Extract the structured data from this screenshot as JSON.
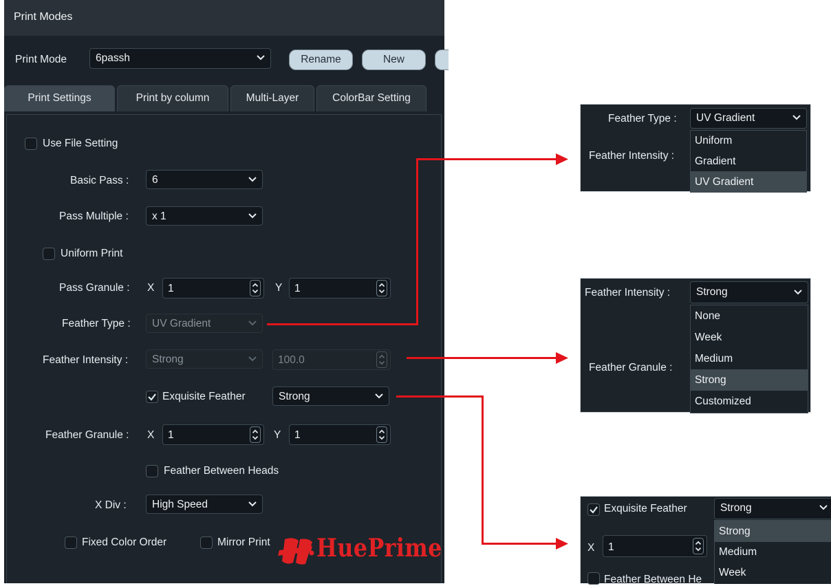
{
  "window": {
    "title": "Print Modes"
  },
  "mode_row": {
    "label": "Print Mode",
    "value": "6passh",
    "rename": "Rename",
    "new": "New"
  },
  "tabs": [
    "Print Settings",
    "Print by column",
    "Multi-Layer",
    "ColorBar Setting"
  ],
  "settings": {
    "use_file_setting": {
      "label": "Use File Setting",
      "checked": false
    },
    "basic_pass": {
      "label": "Basic Pass :",
      "value": "6"
    },
    "pass_multiple": {
      "label": "Pass Multiple :",
      "value": "x 1"
    },
    "uniform_print": {
      "label": "Uniform Print",
      "checked": false
    },
    "pass_granule": {
      "label": "Pass Granule :",
      "x_label": "X",
      "x": "1",
      "y_label": "Y",
      "y": "1"
    },
    "feather_type": {
      "label": "Feather Type :",
      "value": "UV Gradient"
    },
    "feather_intensity": {
      "label": "Feather Intensity :",
      "value": "Strong",
      "number": "100.0"
    },
    "exquisite_feather": {
      "label": "Exquisite Feather",
      "checked": true,
      "value": "Strong"
    },
    "feather_granule": {
      "label": "Feather Granule :",
      "x_label": "X",
      "x": "1",
      "y_label": "Y",
      "y": "1"
    },
    "feather_between_heads": {
      "label": "Feather Between Heads",
      "checked": false
    },
    "x_div": {
      "label": "X Div :",
      "value": "High Speed"
    },
    "fixed_color_order": {
      "label": "Fixed Color Order",
      "checked": false
    },
    "mirror_print": {
      "label": "Mirror Print",
      "checked": false
    }
  },
  "logo": {
    "text": "HuePrime"
  },
  "inset_feather_type": {
    "label": "Feather Type :",
    "value": "UV Gradient",
    "behind_label": "Feather Intensity :",
    "options": [
      "Uniform",
      "Gradient",
      "UV Gradient"
    ],
    "selected": "UV Gradient"
  },
  "inset_feather_intensity": {
    "label": "Feather Intensity :",
    "value": "Strong",
    "behind_label": "Feather Granule :",
    "options": [
      "None",
      "Week",
      "Medium",
      "Strong",
      "Customized"
    ],
    "selected": "Strong"
  },
  "inset_exquisite": {
    "label": "Exquisite Feather",
    "value": "Strong",
    "x_label": "X",
    "x": "1",
    "behind_label": "Feather Between He",
    "options": [
      "Strong",
      "Medium",
      "Week"
    ],
    "selected": "Strong"
  },
  "colors": {
    "annotation_red": "#e3141b",
    "panel_bg": "#1b2229",
    "selected_option": "#3f4950"
  }
}
